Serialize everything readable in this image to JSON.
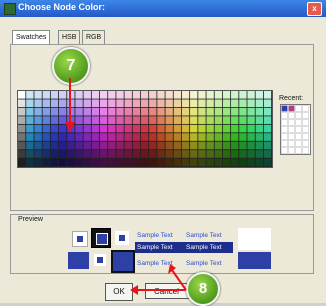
{
  "window": {
    "title": "Choose Node Color:",
    "close_label": "x"
  },
  "tabs": [
    {
      "label": "Swatches",
      "active": true
    },
    {
      "label": "HSB",
      "active": false
    },
    {
      "label": "RGB",
      "active": false
    }
  ],
  "recent": {
    "label": "Recent:"
  },
  "preview": {
    "label": "Preview",
    "sample_text": "Sample Text",
    "selected_color": "#2e3fa6"
  },
  "buttons": {
    "ok_label": "OK",
    "cancel_label": "Cancel"
  },
  "annotations": [
    {
      "number": "7"
    },
    {
      "number": "8"
    }
  ]
}
